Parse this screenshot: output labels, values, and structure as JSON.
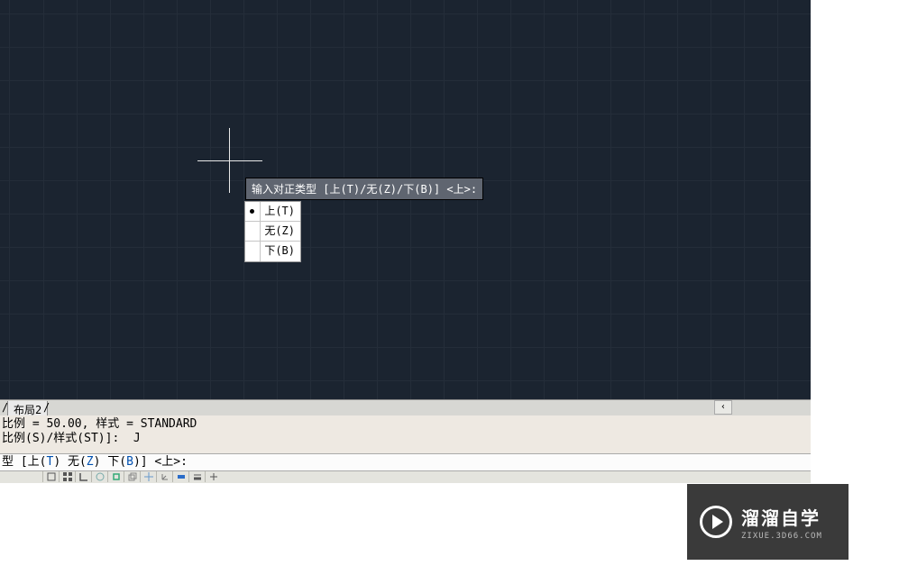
{
  "tooltip": {
    "text": "输入对正类型 [上(T)/无(Z)/下(B)] <上>:"
  },
  "options": [
    {
      "label": "上(T)",
      "selected": true
    },
    {
      "label": "无(Z)",
      "selected": false
    },
    {
      "label": "下(B)",
      "selected": false
    }
  ],
  "tab": {
    "label": "布局2"
  },
  "command_history": {
    "line1": "比例 = 50.00, 样式 = STANDARD",
    "line2": "比例(S)/样式(ST)]:  J"
  },
  "command_prompt": {
    "prefix": "型 [",
    "opt1_pre": "上(",
    "opt1_key": "T",
    "opt1_post": ") ",
    "opt2_pre": "无(",
    "opt2_key": "Z",
    "opt2_post": ") ",
    "opt3_pre": "下(",
    "opt3_key": "B",
    "opt3_post": ")",
    "suffix": "] <上>:"
  },
  "scroll_arrow": "‹",
  "logo": {
    "main": "溜溜自学",
    "sub": "ZIXUE.3D66.COM"
  }
}
